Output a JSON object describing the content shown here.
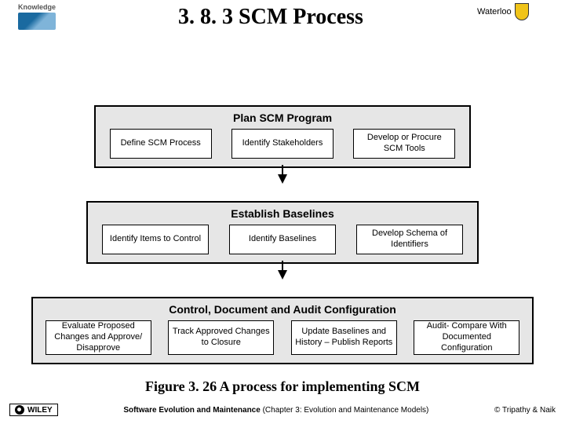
{
  "header": {
    "knowledge_label": "Knowledge",
    "title": "3. 8. 3 SCM Process",
    "waterloo": "Waterloo"
  },
  "phases": {
    "p1": {
      "title": "Plan SCM Program",
      "boxes": [
        "Define SCM Process",
        "Identify Stakeholders",
        "Develop or Procure SCM Tools"
      ]
    },
    "p2": {
      "title": "Establish Baselines",
      "boxes": [
        "Identify Items to Control",
        "Identify Baselines",
        "Develop Schema of Identifiers"
      ]
    },
    "p3": {
      "title": "Control, Document and Audit Configuration",
      "boxes": [
        "Evaluate Proposed Changes and Approve/ Disapprove",
        "Track Approved Changes to Closure",
        "Update Baselines and History – Publish Reports",
        "Audit- Compare With Documented Configuration"
      ]
    }
  },
  "caption": "Figure 3. 26 A process for implementing SCM",
  "footer": {
    "wiley": "WILEY",
    "text": "Software Evolution and Maintenance (Chapter 3: Evolution and Maintenance Models)",
    "credit": "© Tripathy & Naik"
  }
}
